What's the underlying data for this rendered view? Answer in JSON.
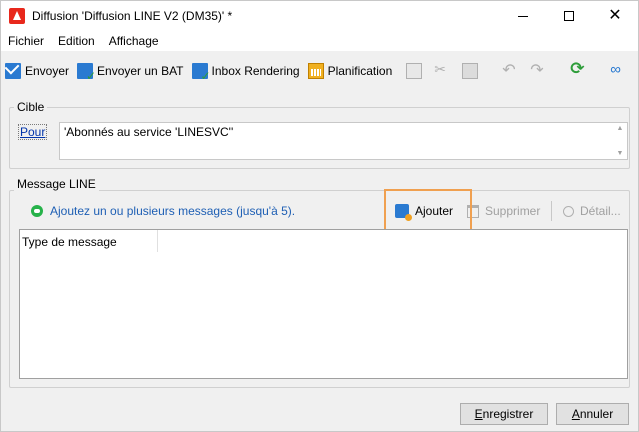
{
  "window": {
    "title": "Diffusion 'Diffusion LINE V2 (DM35)' *",
    "controls": {
      "minimize": "minimize",
      "maximize": "maximize",
      "close": "✕"
    }
  },
  "menu": [
    "Fichier",
    "Edition",
    "Affichage"
  ],
  "toolbar": {
    "envoyer": "Envoyer",
    "envoyer_bat": "Envoyer un BAT",
    "inbox_rendering": "Inbox Rendering",
    "planification": "Planification",
    "icons": [
      "envelope-icon",
      "proof-icon",
      "inbox-rendering-icon",
      "calendar-icon",
      "copy-icon",
      "cut-icon",
      "paste-icon",
      "undo-icon",
      "redo-icon",
      "refresh-icon",
      "link-icon",
      "more-icon"
    ]
  },
  "cible": {
    "legend": "Cible",
    "pour_label": "Pour",
    "target_value": "'Abonnés au service 'LINESVC''"
  },
  "message_line": {
    "legend": "Message LINE",
    "hint": "Ajoutez un ou plusieurs messages (jusqu'à 5).",
    "ajouter": "Ajouter",
    "supprimer": "Supprimer",
    "detail": "Détail...",
    "column_header": "Type de message"
  },
  "buttons": {
    "save_first": "E",
    "save_rest": "nregistrer",
    "cancel_first": "A",
    "cancel_rest": "nnuler"
  },
  "colors": {
    "accent_link": "#0033aa",
    "hint_text": "#1e5fb4",
    "highlight": "#f0a050",
    "line_green": "#27b24a"
  }
}
